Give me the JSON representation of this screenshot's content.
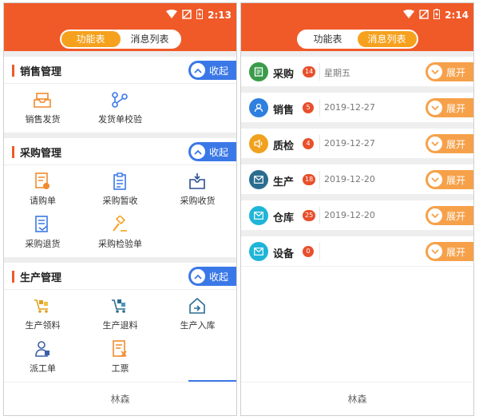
{
  "colors": {
    "brand": "#f05a28",
    "tab_active": "#f6a11e",
    "collapse": "#3b78e7",
    "expand": "#f6a14a",
    "badge": "#e8502c"
  },
  "left": {
    "status": {
      "time": "2:13"
    },
    "tabs": [
      {
        "label": "功能表",
        "active": true
      },
      {
        "label": "消息列表",
        "active": false
      }
    ],
    "sections": [
      {
        "title": "销售管理",
        "toggle": "收起",
        "items": [
          {
            "label": "销售发货",
            "icon": "tray-box-icon"
          },
          {
            "label": "发货单校验",
            "icon": "branch-nodes-icon"
          }
        ]
      },
      {
        "title": "采购管理",
        "toggle": "收起",
        "items": [
          {
            "label": "请购单",
            "icon": "request-form-icon"
          },
          {
            "label": "采购暂收",
            "icon": "clipboard-icon"
          },
          {
            "label": "采购收货",
            "icon": "inbox-receive-icon"
          },
          {
            "label": "采购退货",
            "icon": "return-doc-icon"
          },
          {
            "label": "采购检验单",
            "icon": "hammer-icon"
          }
        ]
      },
      {
        "title": "生产管理",
        "toggle": "收起",
        "items": [
          {
            "label": "生产领料",
            "icon": "cart-icon"
          },
          {
            "label": "生产退料",
            "icon": "cart-return-icon"
          },
          {
            "label": "生产入库",
            "icon": "house-in-icon"
          },
          {
            "label": "派工单",
            "icon": "worker-icon"
          },
          {
            "label": "工票",
            "icon": "ticket-icon"
          }
        ]
      }
    ],
    "footer": "林森"
  },
  "right": {
    "status": {
      "time": "2:14"
    },
    "tabs": [
      {
        "label": "功能表",
        "active": false
      },
      {
        "label": "消息列表",
        "active": true
      }
    ],
    "messages": [
      {
        "name": "采购",
        "count": "14",
        "date": "星期五",
        "icon": "list-icon",
        "color": "#3a9b4a"
      },
      {
        "name": "销售",
        "count": "5",
        "date": "2019-12-27",
        "icon": "user-icon",
        "color": "#2f7fe0"
      },
      {
        "name": "质检",
        "count": "4",
        "date": "2019-12-27",
        "icon": "speaker-icon",
        "color": "#f0a21e"
      },
      {
        "name": "生产",
        "count": "18",
        "date": "2019-12-20",
        "icon": "mail-icon",
        "color": "#2b6d8f"
      },
      {
        "name": "仓库",
        "count": "25",
        "date": "2019-12-20",
        "icon": "mail-icon",
        "color": "#1fb5d8"
      },
      {
        "name": "设备",
        "count": "0",
        "date": "",
        "icon": "mail-icon",
        "color": "#1fb5d8"
      }
    ],
    "expand_label": "展开",
    "footer": "林森"
  }
}
